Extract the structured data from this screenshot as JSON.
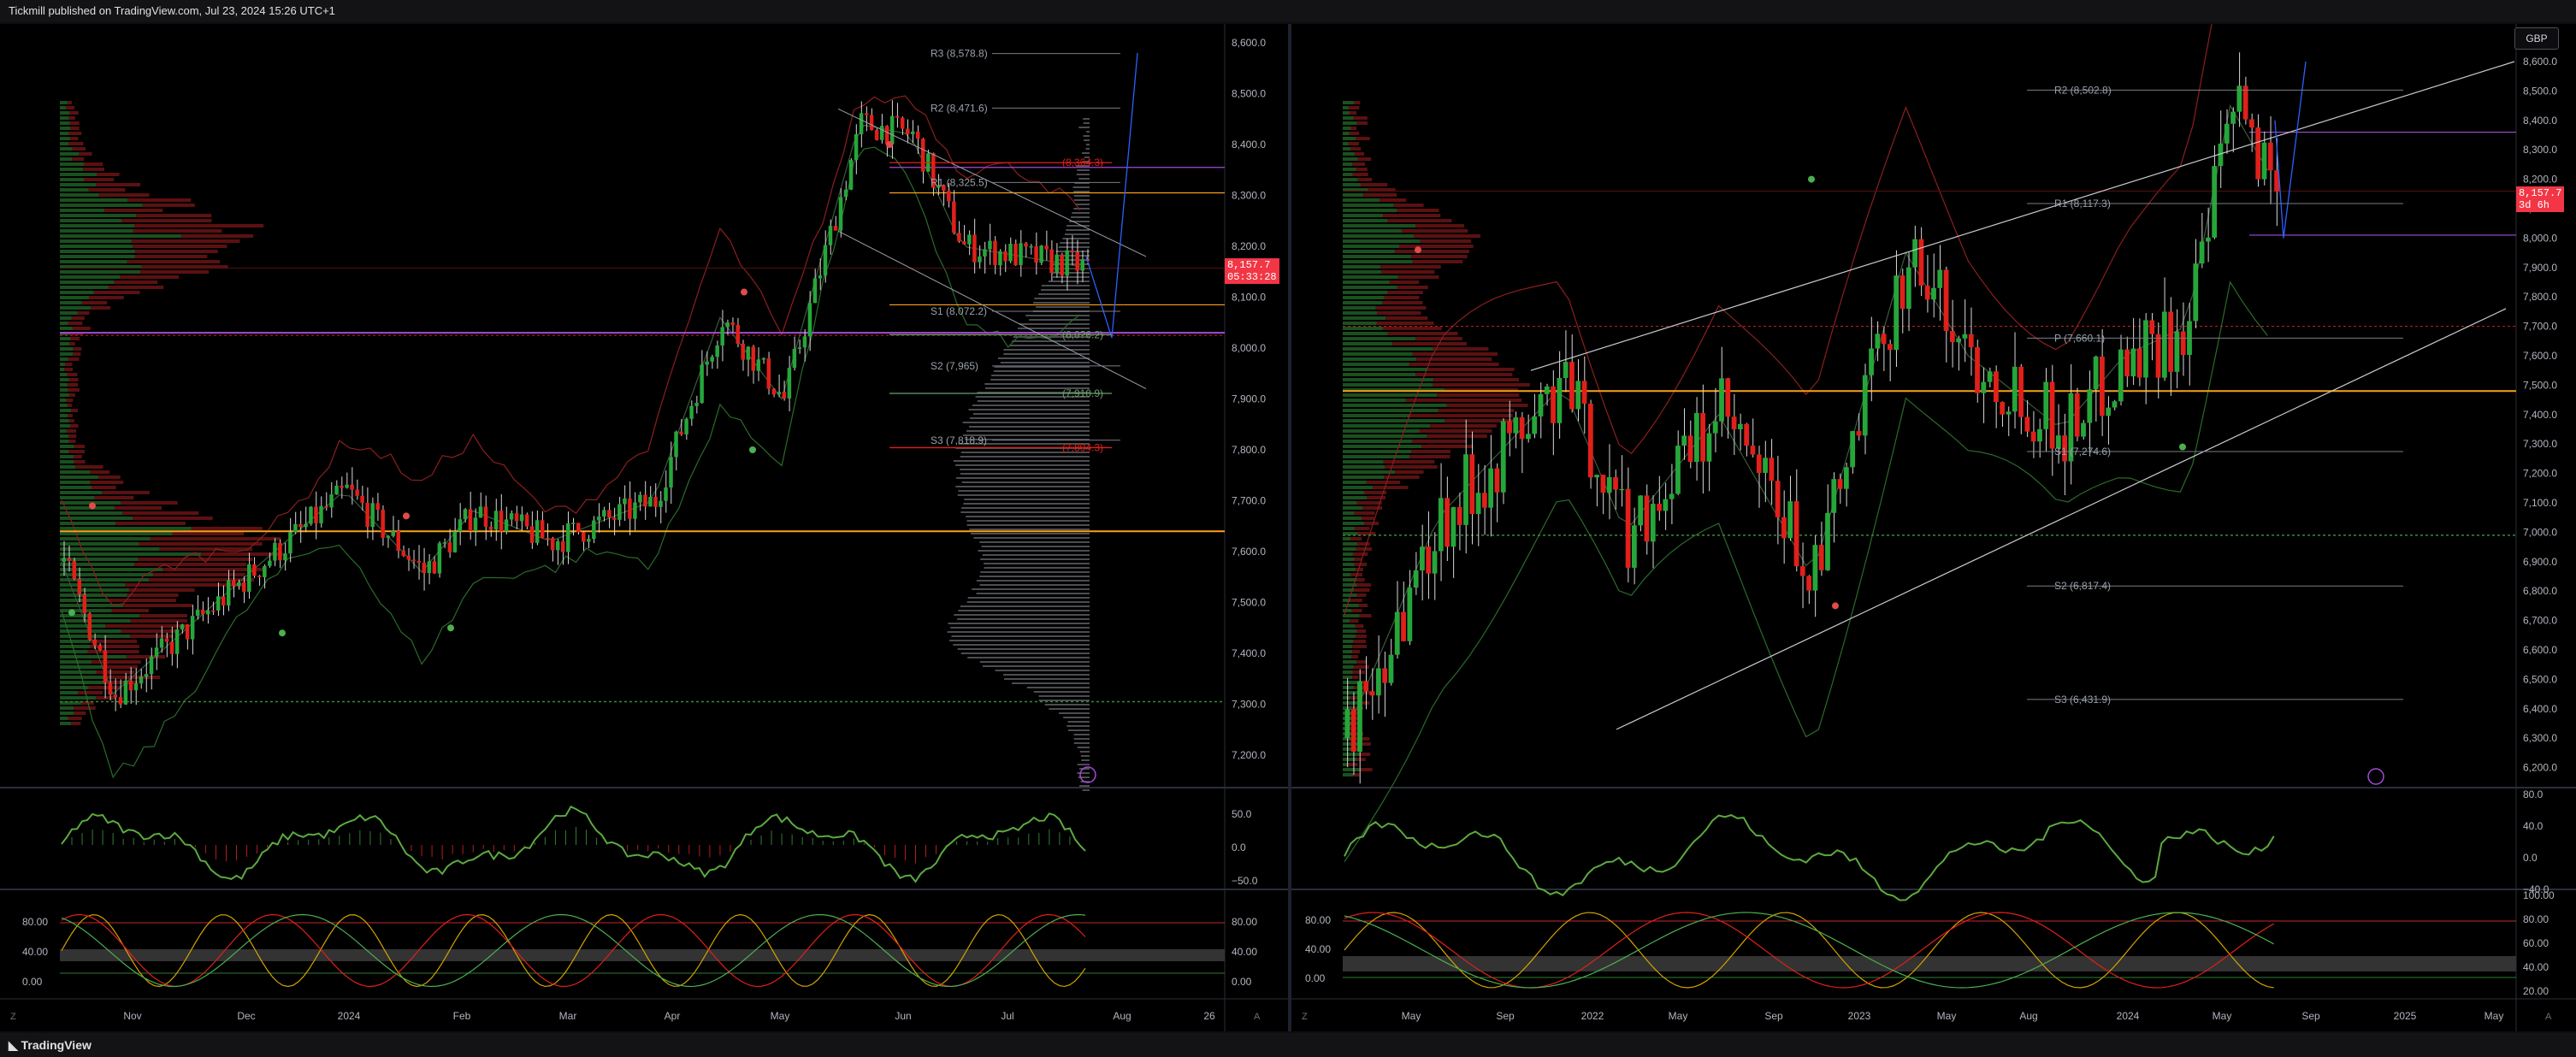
{
  "header": {
    "published_text": "Tickmill published on TradingView.com, Jul 23, 2024 15:26 UTC+1"
  },
  "footer": {
    "brand": "TradingView"
  },
  "colors": {
    "up": "#26a63a",
    "down": "#e0201a",
    "accent_orange": "#f7a21b",
    "purple": "#a24bd7",
    "price_red": "#f23645"
  },
  "left_chart": {
    "price_axis": [
      "8,600.0",
      "8,500.0",
      "8,400.0",
      "8,300.0",
      "8,200.0",
      "8,100.0",
      "8,000.0",
      "7,900.0",
      "7,800.0",
      "7,700.0",
      "7,600.0",
      "7,500.0",
      "7,400.0",
      "7,300.0",
      "7,200.0"
    ],
    "current_price": "8,157.7",
    "countdown": "05:33:28",
    "time_axis": [
      "Nov",
      "Dec",
      "2024",
      "Feb",
      "Mar",
      "Apr",
      "May",
      "Jun",
      "Jul",
      "Aug",
      "26"
    ],
    "pivots": [
      "R3 (8,578.8)",
      "R2 (8,471.6)",
      "R1 (8,325.5)",
      "S1 (8,072.2)",
      "S2 (7,965)",
      "S3 (7,818.9)"
    ],
    "pivot_secondary": [
      "(8,364.3)",
      "(8,0?6.2)",
      "(7,910.9)",
      "(7,804.3)"
    ],
    "macd_axis": [
      "50.0",
      "0.0",
      "−50.0"
    ],
    "stoch_axis_left": [
      "80.00",
      "40.00",
      "0.00"
    ],
    "stoch_axis_right": [
      "80.00",
      "40.00",
      "0.00"
    ]
  },
  "right_chart": {
    "currency": "GBP",
    "price_axis": [
      "8,600.0",
      "8,500.0",
      "8,400.0",
      "8,300.0",
      "8,200.0",
      "8,100.0",
      "8,000.0",
      "7,900.0",
      "7,800.0",
      "7,700.0",
      "7,600.0",
      "7,500.0",
      "7,400.0",
      "7,300.0",
      "7,200.0",
      "7,100.0",
      "7,000.0",
      "6,900.0",
      "6,800.0",
      "6,700.0",
      "6,600.0",
      "6,500.0",
      "6,400.0",
      "6,300.0",
      "6,200.0"
    ],
    "current_price": "8,157.7",
    "countdown": "3d 6h",
    "time_axis": [
      "May",
      "Sep",
      "2022",
      "May",
      "Sep",
      "2023",
      "May",
      "Aug",
      "2024",
      "May",
      "Sep",
      "2025",
      "May"
    ],
    "pivots": [
      "R2 (8,502.8)",
      "R1 (8,117.3)",
      "P (7,660.1)",
      "S1 (7,274.6)",
      "S2 (6,817.4)",
      "S3 (6,431.9)"
    ],
    "macd_axis": [
      "80.0",
      "40.0",
      "0.0",
      "−40.0"
    ],
    "stoch_axis": [
      "100.00",
      "80.00",
      "60.00",
      "40.00",
      "20.00"
    ],
    "stoch_axis_left": [
      "80.00",
      "40.00",
      "0.00"
    ]
  }
}
